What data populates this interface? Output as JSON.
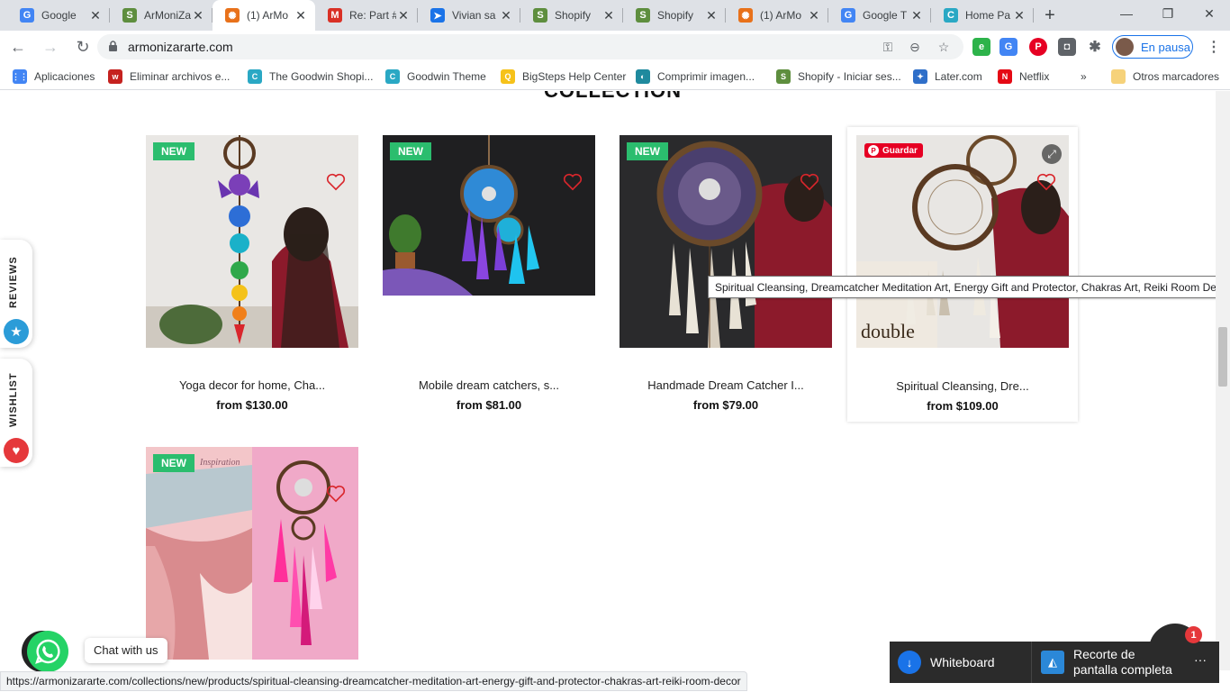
{
  "browser": {
    "tabs": [
      {
        "title": "Google",
        "icon": "google-icon",
        "color": "#4285f4",
        "glyph": "G"
      },
      {
        "title": "ArMoniZa",
        "icon": "shopify-icon",
        "color": "#5e8e3e",
        "glyph": "S"
      },
      {
        "title": "(1) ArMo",
        "icon": "sun-icon",
        "color": "#e8711a",
        "glyph": "✺",
        "active": true
      },
      {
        "title": "Re: Part #",
        "icon": "gmail-icon",
        "color": "#d93025",
        "glyph": "M"
      },
      {
        "title": "Vivian sa",
        "icon": "paper-plane-icon",
        "color": "#1a73e8",
        "glyph": "➤"
      },
      {
        "title": "Shopify",
        "icon": "shopify-icon",
        "color": "#5e8e3e",
        "glyph": "S"
      },
      {
        "title": "Shopify",
        "icon": "shopify-icon",
        "color": "#5e8e3e",
        "glyph": "S"
      },
      {
        "title": "(1) ArMo",
        "icon": "sun-icon",
        "color": "#e8711a",
        "glyph": "✺"
      },
      {
        "title": "Google T",
        "icon": "google-translate-icon",
        "color": "#4285f4",
        "glyph": "G"
      },
      {
        "title": "Home Pa",
        "icon": "goodwin-icon",
        "color": "#2aa8c4",
        "glyph": "C"
      }
    ],
    "new_tab": "+",
    "url": "armonizararte.com",
    "profile_label": "En pausa"
  },
  "bookmarks": [
    {
      "label": "Aplicaciones",
      "icon": "apps-grid-icon",
      "color": "#4285f4",
      "glyph": "⋮⋮"
    },
    {
      "label": "Eliminar archivos e...",
      "icon": "eliminar-icon",
      "color": "#c5221f",
      "glyph": "w"
    },
    {
      "label": "The Goodwin Shopi...",
      "icon": "goodwin-icon",
      "color": "#2aa8c4",
      "glyph": "C"
    },
    {
      "label": "Goodwin Theme",
      "icon": "goodwin-icon",
      "color": "#2aa8c4",
      "glyph": "C"
    },
    {
      "label": "BigSteps Help Center",
      "icon": "bigsteps-icon",
      "color": "#f6c21a",
      "glyph": "Q"
    },
    {
      "label": "Comprimir imagen...",
      "icon": "compress-icon",
      "color": "#1f8a9e",
      "glyph": "◐"
    },
    {
      "label": "Shopify - Iniciar ses...",
      "icon": "shopify-icon",
      "color": "#5e8e3e",
      "glyph": "S"
    },
    {
      "label": "Later.com",
      "icon": "later-icon",
      "color": "#2f6fc9",
      "glyph": "✦"
    },
    {
      "label": "Netflix",
      "icon": "netflix-icon",
      "color": "#e50914",
      "glyph": "N"
    },
    {
      "label": "»",
      "icon": "more-bookmarks-icon",
      "color": "",
      "glyph": ""
    },
    {
      "label": "Otros marcadores",
      "icon": "folder-icon",
      "color": "#f6d27a",
      "glyph": ""
    }
  ],
  "collection_title": "COLLECTION",
  "products": [
    {
      "name": "Yoga decor for home, Cha...",
      "price": "from $130.00",
      "badge": "NEW"
    },
    {
      "name": "Mobile dream catchers, s...",
      "price": "from $81.00",
      "badge": "NEW"
    },
    {
      "name": "Handmade Dream Catcher I...",
      "price": "from $79.00",
      "badge": "NEW"
    },
    {
      "name": "Spiritual Cleansing, Dre...",
      "price": "from $109.00",
      "badge": ""
    },
    {
      "name": "",
      "price": "",
      "badge": "NEW"
    }
  ],
  "pinterest_save": "Guardar",
  "tooltip": "Spiritual Cleansing, Dreamcatcher Meditation Art, Energy Gift and Protector, Chakras Art, Reiki Room Decor",
  "image_text": {
    "double": "double",
    "inspiration": "Inspiration"
  },
  "side_tabs": {
    "reviews": "REVIEWS",
    "wishlist": "WISHLIST"
  },
  "chat_with_us": "Chat with us",
  "status_url": "https://armonizararte.com/collections/new/products/spiritual-cleansing-dreamcatcher-meditation-art-energy-gift-and-protector-chakras-art-reiki-room-decor",
  "snip": {
    "whiteboard": "Whiteboard",
    "recorte_line1": "Recorte de",
    "recorte_line2": "pantalla completa",
    "more": "···"
  },
  "chat_badge": "1"
}
